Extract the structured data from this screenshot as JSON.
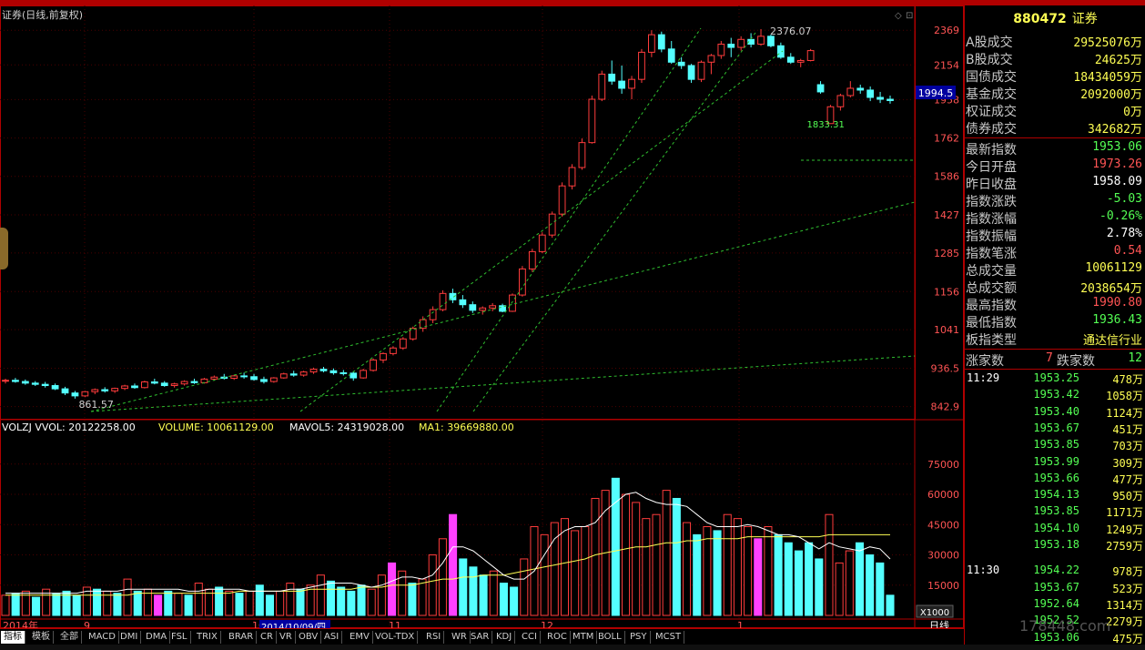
{
  "header": {
    "security_label": "证券(日线,前复权)"
  },
  "chart_data": {
    "type": "candlestick",
    "title": "证券(日线,前复权)",
    "price_axis_ticks": [
      "2369",
      "2154",
      "1958",
      "1762",
      "1586",
      "1427",
      "1285",
      "1156",
      "1041",
      "936.5",
      "842.9"
    ],
    "current_price_tag": "1994.5",
    "annotations": {
      "high": "2376.07",
      "low": "861.57",
      "support": "1833.31"
    },
    "volume_header": {
      "vol": "VOLZJ VVOL: 20122258.00",
      "volume": "VOLUME: 10061129.00",
      "mavol5": "MAVOL5: 24319028.00",
      "ma1": "MA1: 39669880.00"
    },
    "volume_axis_ticks": [
      "75000",
      "60000",
      "45000",
      "30000",
      "15000"
    ],
    "volume_unit": "X1000",
    "x_axis_labels": [
      "2014年",
      "9",
      "10",
      "11",
      "12",
      "1"
    ],
    "date_cursor": "2014/10/09/四",
    "period_label": "日线",
    "ohlc": [
      [
        905,
        910,
        898,
        906
      ],
      [
        906,
        912,
        900,
        903
      ],
      [
        903,
        908,
        895,
        899
      ],
      [
        899,
        904,
        892,
        896
      ],
      [
        896,
        902,
        888,
        893
      ],
      [
        893,
        898,
        882,
        885
      ],
      [
        885,
        890,
        870,
        875
      ],
      [
        875,
        880,
        861.57,
        868
      ],
      [
        868,
        880,
        865,
        878
      ],
      [
        878,
        886,
        872,
        883
      ],
      [
        883,
        889,
        876,
        880
      ],
      [
        880,
        888,
        875,
        886
      ],
      [
        886,
        895,
        882,
        892
      ],
      [
        892,
        898,
        885,
        888
      ],
      [
        888,
        905,
        886,
        902
      ],
      [
        902,
        910,
        896,
        899
      ],
      [
        899,
        904,
        890,
        893
      ],
      [
        893,
        900,
        888,
        897
      ],
      [
        897,
        906,
        893,
        903
      ],
      [
        903,
        910,
        897,
        900
      ],
      [
        900,
        912,
        898,
        909
      ],
      [
        909,
        918,
        905,
        914
      ],
      [
        914,
        922,
        908,
        911
      ],
      [
        911,
        920,
        907,
        917
      ],
      [
        917,
        925,
        910,
        915
      ],
      [
        915,
        922,
        905,
        908
      ],
      [
        908,
        915,
        898,
        903
      ],
      [
        903,
        914,
        900,
        912
      ],
      [
        912,
        925,
        910,
        922
      ],
      [
        922,
        930,
        915,
        919
      ],
      [
        919,
        930,
        915,
        927
      ],
      [
        927,
        938,
        922,
        934
      ],
      [
        934,
        940,
        926,
        930
      ],
      [
        930,
        936,
        920,
        925
      ],
      [
        925,
        932,
        918,
        924
      ],
      [
        924,
        929,
        905,
        912
      ],
      [
        912,
        935,
        910,
        931
      ],
      [
        931,
        962,
        928,
        958
      ],
      [
        958,
        978,
        950,
        975
      ],
      [
        975,
        995,
        970,
        990
      ],
      [
        990,
        1020,
        985,
        1015
      ],
      [
        1015,
        1050,
        1010,
        1045
      ],
      [
        1045,
        1080,
        1035,
        1070
      ],
      [
        1070,
        1110,
        1060,
        1100
      ],
      [
        1100,
        1160,
        1095,
        1150
      ],
      [
        1150,
        1165,
        1120,
        1130
      ],
      [
        1130,
        1145,
        1105,
        1115
      ],
      [
        1115,
        1125,
        1090,
        1098
      ],
      [
        1098,
        1110,
        1085,
        1105
      ],
      [
        1105,
        1120,
        1095,
        1112
      ],
      [
        1112,
        1118,
        1092,
        1095
      ],
      [
        1095,
        1150,
        1093,
        1145
      ],
      [
        1145,
        1240,
        1140,
        1230
      ],
      [
        1230,
        1300,
        1220,
        1290
      ],
      [
        1290,
        1360,
        1285,
        1350
      ],
      [
        1350,
        1440,
        1340,
        1430
      ],
      [
        1430,
        1560,
        1420,
        1545
      ],
      [
        1545,
        1640,
        1530,
        1625
      ],
      [
        1625,
        1760,
        1615,
        1740
      ],
      [
        1740,
        1980,
        1735,
        1960
      ],
      [
        1960,
        2120,
        1950,
        2100
      ],
      [
        2100,
        2180,
        2040,
        2060
      ],
      [
        2060,
        2150,
        1990,
        2020
      ],
      [
        2020,
        2090,
        1960,
        2070
      ],
      [
        2070,
        2250,
        2050,
        2230
      ],
      [
        2230,
        2369,
        2200,
        2340
      ],
      [
        2340,
        2360,
        2230,
        2250
      ],
      [
        2250,
        2300,
        2160,
        2170
      ],
      [
        2170,
        2200,
        2130,
        2150
      ],
      [
        2150,
        2160,
        2050,
        2070
      ],
      [
        2070,
        2180,
        2055,
        2170
      ],
      [
        2170,
        2220,
        2100,
        2210
      ],
      [
        2210,
        2300,
        2190,
        2280
      ],
      [
        2280,
        2320,
        2200,
        2260
      ],
      [
        2260,
        2330,
        2240,
        2310
      ],
      [
        2310,
        2350,
        2260,
        2280
      ],
      [
        2280,
        2376.07,
        2270,
        2330
      ],
      [
        2330,
        2340,
        2260,
        2270
      ],
      [
        2270,
        2290,
        2190,
        2200
      ],
      [
        2200,
        2225,
        2160,
        2170
      ],
      [
        2170,
        2190,
        2140,
        2180
      ],
      [
        2180,
        2250,
        2175,
        2240
      ],
      [
        2040,
        2060,
        1990,
        2000
      ],
      [
        1833.31,
        1930,
        1833.31,
        1920
      ],
      [
        1920,
        1990,
        1900,
        1980
      ],
      [
        1980,
        2060,
        1970,
        2020
      ],
      [
        2020,
        2040,
        1990,
        2010
      ],
      [
        2010,
        2030,
        1950,
        1970
      ],
      [
        1970,
        2000,
        1940,
        1960
      ],
      [
        1960,
        1980,
        1936.43,
        1953
      ]
    ],
    "volume": [
      [
        10,
        "up"
      ],
      [
        11,
        "down"
      ],
      [
        12,
        "up"
      ],
      [
        9,
        "down"
      ],
      [
        13,
        "up"
      ],
      [
        11,
        "down"
      ],
      [
        12,
        "down"
      ],
      [
        10,
        "down"
      ],
      [
        14,
        "up"
      ],
      [
        13,
        "down"
      ],
      [
        12,
        "up"
      ],
      [
        11,
        "down"
      ],
      [
        18,
        "up"
      ],
      [
        12,
        "down"
      ],
      [
        13,
        "up"
      ],
      [
        10,
        "pink"
      ],
      [
        12,
        "down"
      ],
      [
        11,
        "up"
      ],
      [
        10,
        "down"
      ],
      [
        16,
        "up"
      ],
      [
        13,
        "up"
      ],
      [
        14,
        "down"
      ],
      [
        12,
        "up"
      ],
      [
        11,
        "down"
      ],
      [
        12,
        "up"
      ],
      [
        15,
        "down"
      ],
      [
        10,
        "down"
      ],
      [
        12,
        "up"
      ],
      [
        16,
        "up"
      ],
      [
        13,
        "down"
      ],
      [
        15,
        "up"
      ],
      [
        20,
        "up"
      ],
      [
        17,
        "down"
      ],
      [
        14,
        "down"
      ],
      [
        12,
        "down"
      ],
      [
        15,
        "down"
      ],
      [
        13,
        "up"
      ],
      [
        20,
        "up"
      ],
      [
        26,
        "pink"
      ],
      [
        22,
        "up"
      ],
      [
        16,
        "down"
      ],
      [
        18,
        "up"
      ],
      [
        30,
        "up"
      ],
      [
        38,
        "up"
      ],
      [
        50,
        "pink"
      ],
      [
        28,
        "down"
      ],
      [
        24,
        "down"
      ],
      [
        20,
        "down"
      ],
      [
        22,
        "up"
      ],
      [
        16,
        "down"
      ],
      [
        14,
        "down"
      ],
      [
        28,
        "up"
      ],
      [
        44,
        "up"
      ],
      [
        40,
        "up"
      ],
      [
        46,
        "up"
      ],
      [
        48,
        "up"
      ],
      [
        42,
        "up"
      ],
      [
        44,
        "up"
      ],
      [
        58,
        "up"
      ],
      [
        62,
        "up"
      ],
      [
        68,
        "down"
      ],
      [
        60,
        "up"
      ],
      [
        56,
        "up"
      ],
      [
        48,
        "up"
      ],
      [
        50,
        "up"
      ],
      [
        62,
        "up"
      ],
      [
        58,
        "down"
      ],
      [
        46,
        "up"
      ],
      [
        40,
        "down"
      ],
      [
        44,
        "up"
      ],
      [
        42,
        "down"
      ],
      [
        50,
        "up"
      ],
      [
        48,
        "up"
      ],
      [
        44,
        "up"
      ],
      [
        38,
        "pink"
      ],
      [
        44,
        "up"
      ],
      [
        40,
        "down"
      ],
      [
        36,
        "down"
      ],
      [
        32,
        "down"
      ],
      [
        36,
        "down"
      ],
      [
        28,
        "down"
      ],
      [
        50,
        "up"
      ],
      [
        26,
        "up"
      ],
      [
        32,
        "up"
      ],
      [
        36,
        "down"
      ],
      [
        30,
        "down"
      ],
      [
        26,
        "down"
      ],
      [
        10,
        "down"
      ]
    ],
    "mavol5": [
      11,
      11,
      11,
      11,
      11,
      11,
      11,
      11,
      12,
      12,
      12,
      12,
      13,
      13,
      13,
      13,
      13,
      13,
      12,
      12,
      13,
      13,
      13,
      13,
      12,
      12,
      12,
      12,
      13,
      13,
      14,
      15,
      16,
      16,
      16,
      15,
      14,
      15,
      17,
      19,
      19,
      18,
      20,
      26,
      34,
      34,
      32,
      28,
      24,
      20,
      18,
      18,
      22,
      30,
      38,
      42,
      44,
      44,
      46,
      52,
      56,
      60,
      61,
      58,
      56,
      55,
      55,
      54,
      50,
      46,
      44,
      44,
      44,
      45,
      44,
      42,
      40,
      40,
      39,
      36,
      33,
      36,
      34,
      33,
      32,
      34,
      33,
      28
    ],
    "ma1": [
      10,
      10,
      10,
      10,
      10,
      10,
      10,
      10,
      10,
      10,
      10,
      10,
      10,
      11,
      11,
      11,
      11,
      11,
      11,
      11,
      11,
      11,
      11,
      12,
      12,
      12,
      12,
      12,
      12,
      12,
      13,
      13,
      13,
      13,
      13,
      14,
      14,
      14,
      15,
      15,
      15,
      16,
      17,
      18,
      18,
      19,
      19,
      20,
      20,
      20,
      21,
      22,
      23,
      24,
      25,
      26,
      27,
      28,
      30,
      31,
      32,
      33,
      34,
      34,
      35,
      36,
      36,
      37,
      37,
      38,
      38,
      38,
      38,
      39,
      39,
      39,
      39,
      39,
      39,
      39,
      39,
      40,
      40,
      40,
      40,
      40,
      40,
      40
    ]
  },
  "right_panel": {
    "code": "880472",
    "name": "证券",
    "stats_top": [
      {
        "label": "A股成交",
        "value": "29525076万",
        "color": "#ffff54"
      },
      {
        "label": "B股成交",
        "value": "24625万",
        "color": "#ffff54"
      },
      {
        "label": "国债成交",
        "value": "18434059万",
        "color": "#ffff54"
      },
      {
        "label": "基金成交",
        "value": "2092000万",
        "color": "#ffff54"
      },
      {
        "label": "权证成交",
        "value": "0万",
        "color": "#ffff54"
      },
      {
        "label": "债券成交",
        "value": "342682万",
        "color": "#ffff54"
      }
    ],
    "stats_mid": [
      {
        "label": "最新指数",
        "value": "1953.06",
        "color": "#54ff54"
      },
      {
        "label": "今日开盘",
        "value": "1973.26",
        "color": "#ff5454"
      },
      {
        "label": "昨日收盘",
        "value": "1958.09",
        "color": "#ffffff"
      },
      {
        "label": "指数涨跌",
        "value": "-5.03",
        "color": "#54ff54"
      },
      {
        "label": "指数涨幅",
        "value": "-0.26%",
        "color": "#54ff54"
      },
      {
        "label": "指数振幅",
        "value": "2.78%",
        "color": "#ffffff"
      },
      {
        "label": "指数笔涨",
        "value": "0.54",
        "color": "#ff5454"
      },
      {
        "label": "总成交量",
        "value": "10061129",
        "color": "#ffff54"
      },
      {
        "label": "总成交额",
        "value": "2038654万",
        "color": "#ffff54"
      },
      {
        "label": "最高指数",
        "value": "1990.80",
        "color": "#ff5454"
      },
      {
        "label": "最低指数",
        "value": "1936.43",
        "color": "#54ff54"
      },
      {
        "label": "板指类型",
        "value": "通达信行业",
        "color": "#ffff54"
      }
    ],
    "rise_label": "涨家数",
    "rise_value": "7",
    "fall_label": "跌家数",
    "fall_value": "12",
    "ticks": [
      {
        "time": "11:29",
        "price": "1953.25",
        "vol": "478万"
      },
      {
        "time": "",
        "price": "1953.42",
        "vol": "1058万"
      },
      {
        "time": "",
        "price": "1953.40",
        "vol": "1124万"
      },
      {
        "time": "",
        "price": "1953.67",
        "vol": "451万"
      },
      {
        "time": "",
        "price": "1953.85",
        "vol": "703万"
      },
      {
        "time": "",
        "price": "1953.99",
        "vol": "309万"
      },
      {
        "time": "",
        "price": "1953.66",
        "vol": "477万"
      },
      {
        "time": "",
        "price": "1954.13",
        "vol": "950万"
      },
      {
        "time": "",
        "price": "1953.85",
        "vol": "1171万"
      },
      {
        "time": "",
        "price": "1954.10",
        "vol": "1249万"
      },
      {
        "time": "",
        "price": "1953.18",
        "vol": "2759万"
      },
      {
        "time": "11:30",
        "price": "1954.22",
        "vol": "978万"
      },
      {
        "time": "",
        "price": "1953.67",
        "vol": "523万"
      },
      {
        "time": "",
        "price": "1952.64",
        "vol": "1314万"
      },
      {
        "time": "",
        "price": "1952.52",
        "vol": "2279万"
      },
      {
        "time": "",
        "price": "1953.06",
        "vol": "475万"
      }
    ]
  },
  "tabs": [
    "指标",
    "模板",
    "全部",
    "MACD",
    "DMI",
    "DMA",
    "FSL",
    "TRIX",
    "BRAR",
    "CR",
    "VR",
    "OBV",
    "ASI",
    "EMV",
    "VOL-TDX",
    "RSI",
    "WR",
    "SAR",
    "KDJ",
    "CCI",
    "ROC",
    "MTM",
    "BOLL",
    "PSY",
    "MCST"
  ],
  "watermark": "178448.com"
}
